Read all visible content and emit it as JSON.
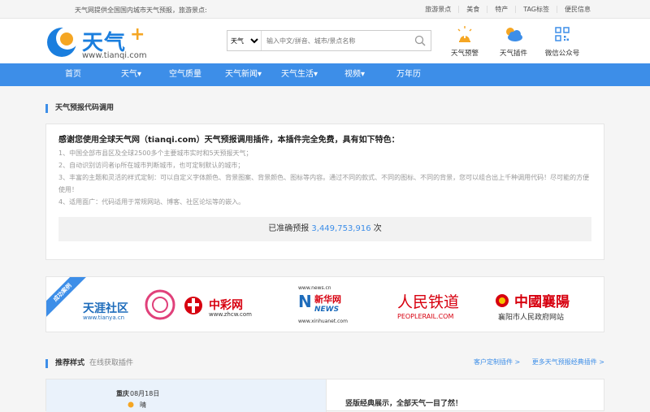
{
  "topbar": {
    "slogan": "天气网提供全国国内城市天气预报，旅游景点:",
    "links": [
      "旅游景点",
      "美食",
      "特产",
      "TAG标签",
      "便民信息"
    ]
  },
  "logo": {
    "text": "天气",
    "plus": "+",
    "url": "www.tianqi.com"
  },
  "search": {
    "type_selected": "天气",
    "placeholder": "输入中文/拼音、城市/景点名称"
  },
  "header_icons": [
    {
      "label": "天气预警",
      "icon": "warning-icon"
    },
    {
      "label": "天气插件",
      "icon": "weather-plugin-icon"
    },
    {
      "label": "微信公众号",
      "icon": "qrcode-icon"
    }
  ],
  "nav": [
    "首页",
    "天气▾",
    "空气质量",
    "天气新闻▾",
    "天气生活▾",
    "视频▾",
    "万年历"
  ],
  "section1": {
    "title": "天气预报代码调用"
  },
  "features": {
    "headline": "感谢您使用全球天气网（tianqi.com）天气预报调用插件，本插件完全免费，具有如下特色：",
    "items": [
      "1、中国全部市县区及全球2500多个主要城市实时和5天预报天气；",
      "2、自动识别访问者ip所在城市判断城市，也可定制默认的城市；",
      "3、丰富的主题和灵活的样式定制：可以自定义字体颜色、背景图案、背景颜色、图标等内容。通过不同的款式、不同的图标、不同的背景，您可以组合出上千种调用代码！尽可能的方便使用！",
      "4、适用面广：代码适用于常规网站、博客、社区论坛等的嵌入。"
    ],
    "stats_prefix": "已准确预报",
    "stats_count": "3,449,753,916",
    "stats_suffix": "次"
  },
  "partners": {
    "ribbon": "成功案例",
    "items": [
      {
        "name": "天涯社区",
        "url": "www.tianya.cn"
      },
      {
        "name": "中彩网",
        "url": "www.zhcw.com"
      },
      {
        "name": "新华网",
        "url": "www.xinhuanet.com",
        "top": "www.news.cn",
        "mark": "NEWS"
      },
      {
        "name": "人民铁道",
        "url": "PEOPLERAIL.COM"
      },
      {
        "name": "中國襄陽",
        "url": "襄阳市人民政府网站"
      }
    ]
  },
  "section2": {
    "title": "推荐样式",
    "subtitle": "在线获取插件",
    "links": [
      "客户定制插件 >",
      "更多天气预报经典插件 >"
    ]
  },
  "preview": {
    "city": "重庆",
    "date": "08月18日",
    "weather": "晴",
    "text": "竖版经典展示，全部天气一目了然！"
  },
  "colors": {
    "accent": "#3d8ee8",
    "logo_blue": "#1a7ede",
    "logo_orange": "#f5a623"
  }
}
